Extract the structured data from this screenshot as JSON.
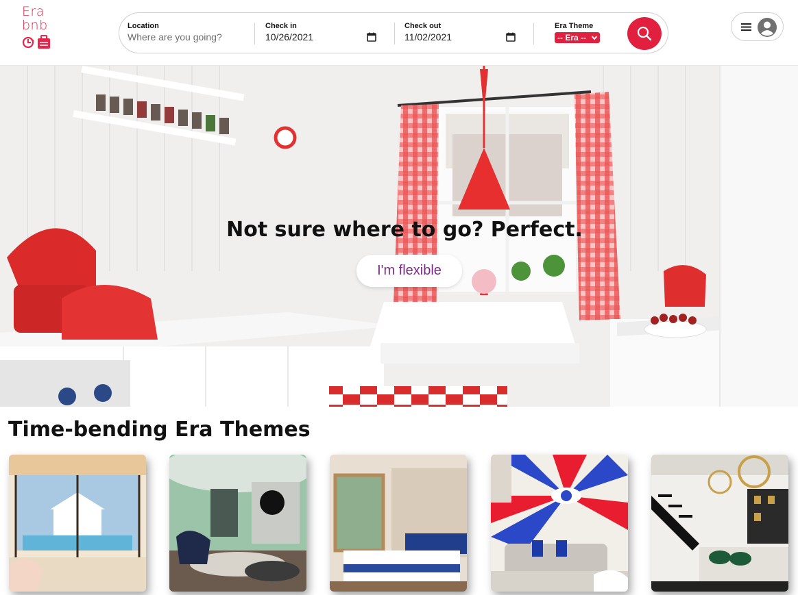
{
  "logo": {
    "line1": "Era",
    "line2": "bnb",
    "icon": "clock-suitcase-icon"
  },
  "search": {
    "location": {
      "label": "Location",
      "placeholder": "Where are you going?"
    },
    "check_in": {
      "label": "Check in",
      "value": "10/26/2021"
    },
    "check_out": {
      "label": "Check out",
      "value": "11/02/2021"
    },
    "era_theme": {
      "label": "Era Theme",
      "selected": "-- Era --"
    },
    "button_icon": "search-icon"
  },
  "user_menu": {
    "menu_icon": "hamburger-icon",
    "avatar_icon": "user-avatar-icon"
  },
  "hero": {
    "title": "Not sure where to go? Perfect.",
    "button": "I'm flexible"
  },
  "themes": {
    "title": "Time-bending Era Themes",
    "cards": [
      {
        "name": "poolside-villa"
      },
      {
        "name": "mid-century-lounge"
      },
      {
        "name": "modern-bedroom"
      },
      {
        "name": "pop-art-living-room"
      },
      {
        "name": "industrial-loft"
      }
    ]
  },
  "colors": {
    "accent": "#e1203f",
    "brand": "#e5254a",
    "flexible_text": "#7b2b86"
  }
}
